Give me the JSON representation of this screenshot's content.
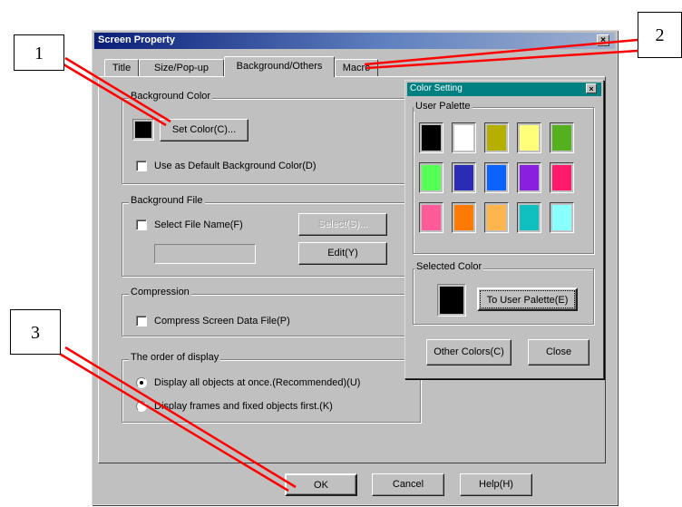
{
  "window": {
    "title": "Screen Property",
    "close_glyph": "×"
  },
  "tabs": [
    {
      "label": "Title"
    },
    {
      "label": "Size/Pop-up"
    },
    {
      "label": "Background/Others"
    },
    {
      "label": "Macro"
    }
  ],
  "background_color": {
    "group_label": "Background Color",
    "current_color": "#000000",
    "set_color_button": "Set Color(C)...",
    "use_default_checkbox": "Use as Default Background Color(D)"
  },
  "background_file": {
    "group_label": "Background File",
    "select_checkbox": "Select File Name(F)",
    "select_button": "Select(S)...",
    "edit_button": "Edit(Y)",
    "file_value": ""
  },
  "compression": {
    "group_label": "Compression",
    "compress_checkbox": "Compress Screen Data File(P)"
  },
  "display_order": {
    "group_label": "The order of display",
    "option_all": "Display all objects at once.(Recommended)(U)",
    "option_frames": "Display frames and fixed objects first.(K)",
    "selected": "option_all"
  },
  "footer": {
    "ok_button": "OK",
    "cancel_button": "Cancel",
    "help_button": "Help(H)"
  },
  "color_setting": {
    "title": "Color Setting",
    "close_glyph": "×",
    "user_palette_label": "User Palette",
    "palette": [
      "#000000",
      "#ffffff",
      "#b5b000",
      "#ffff7a",
      "#55b020",
      "#55ff55",
      "#2b2bb5",
      "#0a63ff",
      "#8a1fe0",
      "#ff1a6e",
      "#ff5a9a",
      "#ff7a05",
      "#ffb54d",
      "#10c0c0",
      "#8affff"
    ],
    "selected_color_label": "Selected Color",
    "selected_color": "#000000",
    "to_user_palette_button": "To User Palette(E)",
    "other_colors_button": "Other Colors(C)",
    "close_button": "Close"
  },
  "callouts": [
    {
      "label": "1"
    },
    {
      "label": "2"
    },
    {
      "label": "3"
    }
  ],
  "accent": {
    "callout_line": "#ff0000",
    "titlebar": "#0a1e78",
    "cs_titlebar": "#008080"
  }
}
